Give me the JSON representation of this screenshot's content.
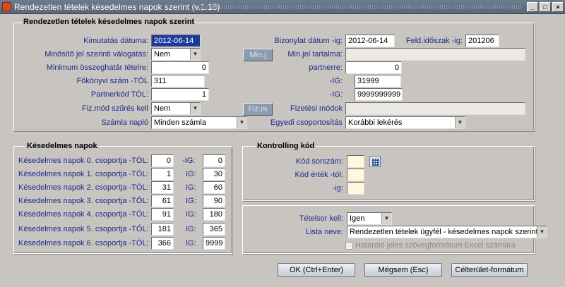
{
  "window": {
    "title": "Rendezetlen tételek késedelmes napok szerint (v.1.18)",
    "min_glyph": "_",
    "max_glyph": "□",
    "close_glyph": "×"
  },
  "main": {
    "title": "Rendezetlen tételek késedelmes napok szerint",
    "kimutatas_datuma_label": "Kimutatás dátuma:",
    "kimutatas_datuma_value": "2012-06-14",
    "bizonylat_datum_label": "Bizonylat dátum -ig:",
    "bizonylat_datum_value": "2012-06-14",
    "feld_idoszak_label": "Feld.időszak -ig:",
    "feld_idoszak_value": "201206",
    "minosito_label": "Minősítő jel szerinti válogatás:",
    "minosito_value": "Nem",
    "minj_button": "Min.j",
    "minjel_tartalma_label": "Min.jel tartalma:",
    "minjel_tartalma_value": "",
    "minimum_label": "Minimum összeghatár tételre:",
    "minimum_value": "0",
    "partnerre_label": "partnerre:",
    "partnerre_value": "0",
    "fokonyvi_label": "Főkönyvi szám  -TÓL",
    "fokonyvi_tol_value": "311",
    "fokonyvi_ig_label": "-IG:",
    "fokonyvi_ig_value": "31999",
    "partnerkod_label": "Partnerkód TÓL:",
    "partnerkod_tol_value": "1",
    "partnerkod_ig_label": "-IG:",
    "partnerkod_ig_value": "9999999999",
    "fizmod_label": "Fiz.mód szűrés kell",
    "fizmod_value": "Nem",
    "fizm_button": "Fiz.m",
    "fizetesi_modok_label": "Fizetési módok",
    "fizetesi_modok_value": "",
    "szamla_naplo_label": "Számla napló",
    "szamla_naplo_value": "Minden számla",
    "egyedi_label": "Egyedi csoportosítás",
    "egyedi_value": "Korábbi lekérés"
  },
  "kesedelmes": {
    "title": "Késedelmes napok",
    "rows": [
      {
        "label": "Késedelmes napok 0. csoportja -TÓL:",
        "ig_label": "-IG:",
        "tol": "0",
        "ig": "0"
      },
      {
        "label": "Késedelmes napok 1. csoportja -TÓL:",
        "ig_label": "IG:",
        "tol": "1",
        "ig": "30"
      },
      {
        "label": "Késedelmes napok 2. csoportja -TÓL:",
        "ig_label": "IG:",
        "tol": "31",
        "ig": "60"
      },
      {
        "label": "Késedelmes napok 3. csoportja -TÓL:",
        "ig_label": "IG:",
        "tol": "61",
        "ig": "90"
      },
      {
        "label": "Késedelmes napok 4. csoportja -TÓL:",
        "ig_label": "IG:",
        "tol": "91",
        "ig": "180"
      },
      {
        "label": "Késedelmes napok 5. csoportja -TÓL:",
        "ig_label": "IG:",
        "tol": "181",
        "ig": "365"
      },
      {
        "label": "Késedelmes napok 6. csoportja -TÓL:",
        "ig_label": "IG:",
        "tol": "366",
        "ig": "9999"
      }
    ]
  },
  "kontrolling": {
    "title": "Kontrolling kód",
    "kod_sorszam_label": "Kód sorszám:",
    "kod_sorszam_value": "",
    "kod_ertek_tol_label": "Kód érték -tól:",
    "kod_ertek_tol_value": "",
    "ig_label": "-ig:",
    "ig_value": ""
  },
  "output": {
    "tetelsor_label": "Tételsor kell:",
    "tetelsor_value": "Igen",
    "lista_neve_label": "Lista neve:",
    "lista_neve_value": "Rendezetlen tételek ügyfél - késedelmes napok szerint",
    "checkbox_label": "Határoló jeles szövegformátum  Excel számára"
  },
  "buttons": {
    "ok": "OK (Ctrl+Enter)",
    "cancel": "Mégsem (Esc)",
    "format": "Célterület-formátum"
  }
}
